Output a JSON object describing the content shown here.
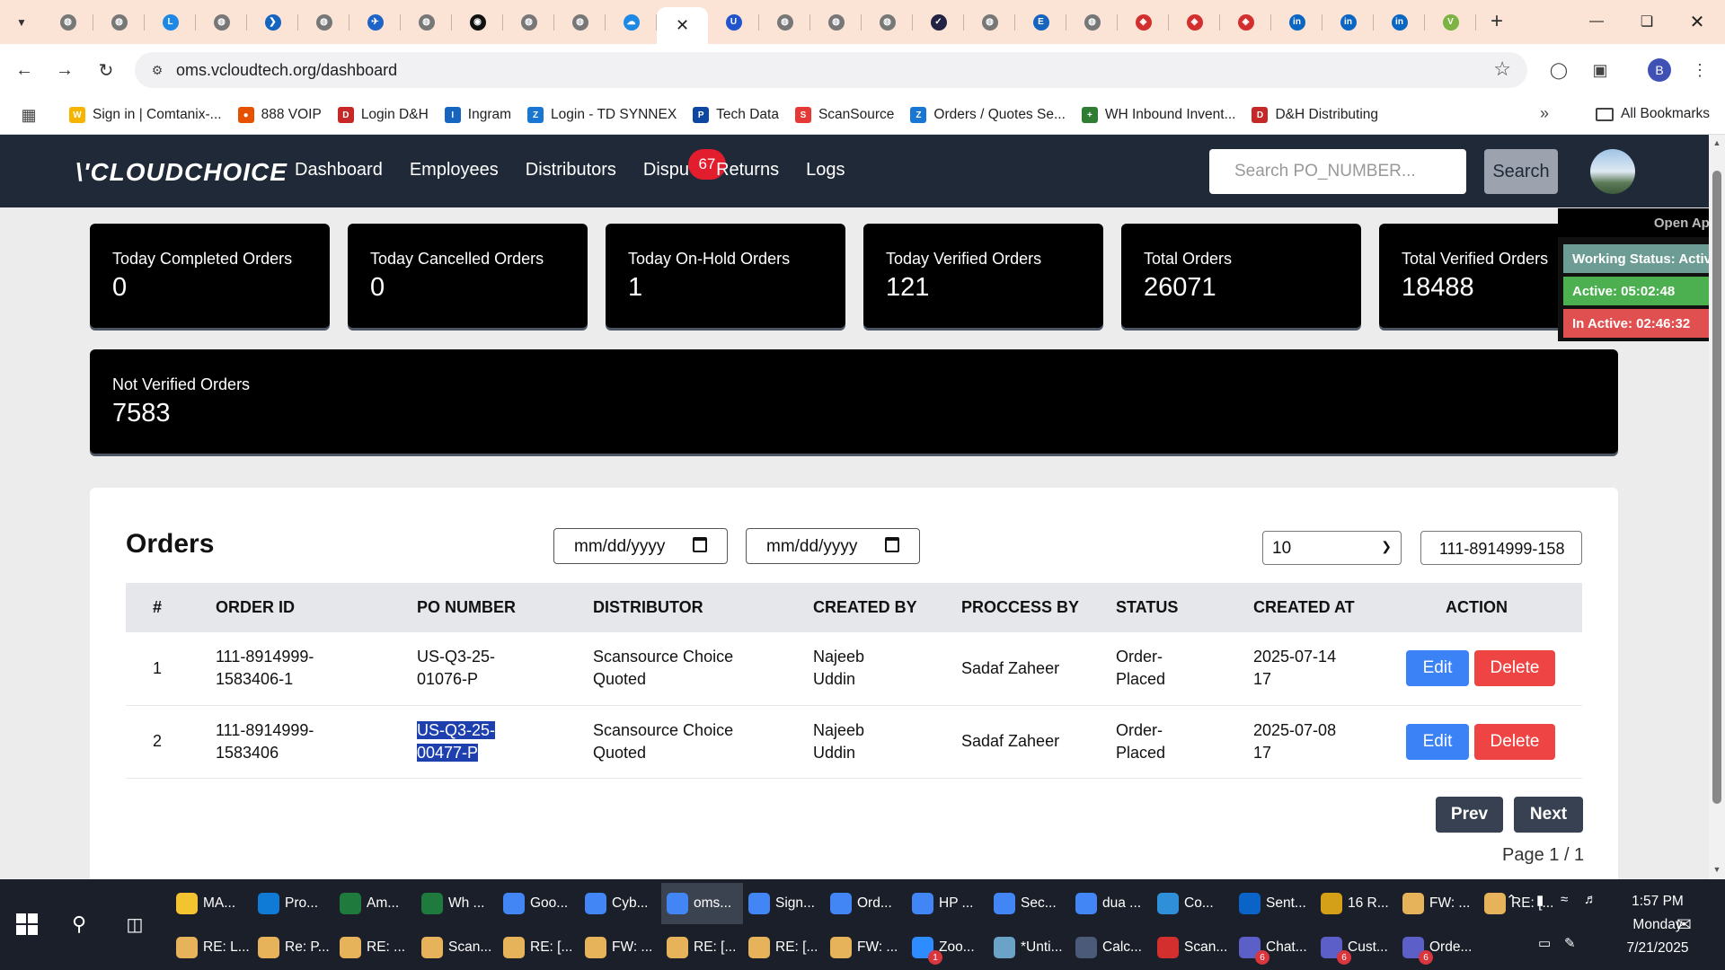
{
  "browser": {
    "tabs": [
      {
        "icon": "globe-icon",
        "color": "#777777",
        "glyph": "◍"
      },
      {
        "icon": "globe-icon",
        "color": "#777777",
        "glyph": "◍"
      },
      {
        "icon": "logi-icon",
        "color": "#1e88e5",
        "glyph": "L"
      },
      {
        "icon": "globe-icon",
        "color": "#777777",
        "glyph": "◍"
      },
      {
        "icon": "chevron-logo-icon",
        "color": "#1565c0",
        "glyph": "❯"
      },
      {
        "icon": "globe-icon",
        "color": "#777777",
        "glyph": "◍"
      },
      {
        "icon": "bird-logo-icon",
        "color": "#1e63c8",
        "glyph": "✈"
      },
      {
        "icon": "globe-icon",
        "color": "#777777",
        "glyph": "◍"
      },
      {
        "icon": "camera-lens-icon",
        "color": "#111111",
        "glyph": "◉"
      },
      {
        "icon": "globe-icon",
        "color": "#777777",
        "glyph": "◍"
      },
      {
        "icon": "globe-icon",
        "color": "#777777",
        "glyph": "◍"
      },
      {
        "icon": "cloud-logo-icon",
        "color": "#1e88e5",
        "glyph": "☁"
      },
      {
        "icon": "close-icon",
        "color": "#222222",
        "glyph": "✕",
        "active": true
      },
      {
        "icon": "u-logo-icon",
        "color": "#2155cd",
        "glyph": "U"
      },
      {
        "icon": "globe-icon",
        "color": "#777777",
        "glyph": "◍"
      },
      {
        "icon": "globe-icon",
        "color": "#777777",
        "glyph": "◍"
      },
      {
        "icon": "globe-icon",
        "color": "#777777",
        "glyph": "◍"
      },
      {
        "icon": "check-logo-icon",
        "color": "#222244",
        "glyph": "✓"
      },
      {
        "icon": "globe-icon",
        "color": "#777777",
        "glyph": "◍"
      },
      {
        "icon": "etn-logo-icon",
        "color": "#1565c0",
        "glyph": "E"
      },
      {
        "icon": "globe-icon",
        "color": "#777777",
        "glyph": "◍"
      },
      {
        "icon": "shield-red-icon",
        "color": "#d32f2f",
        "glyph": "◈"
      },
      {
        "icon": "shield-red-icon",
        "color": "#d32f2f",
        "glyph": "◈"
      },
      {
        "icon": "shield-red-icon",
        "color": "#d32f2f",
        "glyph": "◈"
      },
      {
        "icon": "linkedin-icon",
        "color": "#0a66c2",
        "glyph": "in"
      },
      {
        "icon": "linkedin-icon",
        "color": "#0a66c2",
        "glyph": "in"
      },
      {
        "icon": "linkedin-icon",
        "color": "#0a66c2",
        "glyph": "in"
      },
      {
        "icon": "v-logo-icon",
        "color": "#7cb342",
        "glyph": "V"
      }
    ],
    "url": "oms.vcloudtech.org/dashboard",
    "profile_letter": "B",
    "bookmarks": [
      {
        "label": "Sign in | Comtanix-...",
        "icon": "w-logo-icon",
        "color": "#f4b400",
        "glyph": "W"
      },
      {
        "label": "888 VOIP",
        "icon": "people-icon",
        "color": "#e65100",
        "glyph": "●"
      },
      {
        "label": "Login D&H",
        "icon": "dh-logo-icon",
        "color": "#c62828",
        "glyph": "D"
      },
      {
        "label": "Ingram",
        "icon": "ingram-logo-icon",
        "color": "#1565c0",
        "glyph": "I"
      },
      {
        "label": "Login - TD SYNNEX",
        "icon": "zc-logo-icon",
        "color": "#1976d2",
        "glyph": "Z"
      },
      {
        "label": "Tech Data",
        "icon": "p-logo-icon",
        "color": "#0d47a1",
        "glyph": "P"
      },
      {
        "label": "ScanSource",
        "icon": "scansource-logo-icon",
        "color": "#e53935",
        "glyph": "S"
      },
      {
        "label": "Orders / Quotes Se...",
        "icon": "zc-logo-icon",
        "color": "#1976d2",
        "glyph": "Z"
      },
      {
        "label": "WH Inbound Invent...",
        "icon": "plus-green-icon",
        "color": "#2e7d32",
        "glyph": "+"
      },
      {
        "label": "D&H Distributing",
        "icon": "dh-logo-icon",
        "color": "#c62828",
        "glyph": "D"
      }
    ],
    "all_bookmarks_label": "All Bookmarks"
  },
  "app": {
    "logo_text": "\\'CLOUDCHOICE",
    "nav": [
      {
        "label": "Dashboard"
      },
      {
        "label": "Employees"
      },
      {
        "label": "Distributors"
      },
      {
        "label": "Dispu",
        "badge": "67"
      },
      {
        "label": "Returns"
      },
      {
        "label": "Logs"
      }
    ],
    "search_placeholder": "Search PO_NUMBER...",
    "search_button": "Search",
    "stats": [
      {
        "label": "Today Completed Orders",
        "value": "0"
      },
      {
        "label": "Today Cancelled Orders",
        "value": "0"
      },
      {
        "label": "Today On-Hold Orders",
        "value": "1"
      },
      {
        "label": "Today Verified Orders",
        "value": "121"
      },
      {
        "label": "Total Orders",
        "value": "26071"
      },
      {
        "label": "Total Verified Orders",
        "value": "18488"
      }
    ],
    "not_verified": {
      "label": "Not Verified Orders",
      "value": "7583"
    },
    "widget": {
      "open_app": "Open App",
      "working_status": "Working Status: Active",
      "active": "Active: 05:02:48",
      "inactive": "In Active: 02:46:32",
      "colors": {
        "status": "#6c9c93",
        "active": "#4caf50",
        "inactive": "#e05050"
      }
    },
    "orders": {
      "title": "Orders",
      "date_from": "mm/dd/yyyy",
      "date_to": "mm/dd/yyyy",
      "page_size": "10",
      "filter_value": "111-8914999-158",
      "columns": [
        "#",
        "ORDER ID",
        "PO NUMBER",
        "DISTRIBUTOR",
        "CREATED BY",
        "PROCCESS BY",
        "STATUS",
        "CREATED AT",
        "ACTION"
      ],
      "rows": [
        {
          "num": "1",
          "order_id": [
            "111-8914999-",
            "1583406-1"
          ],
          "po": [
            "US-Q3-25-",
            "01076-P"
          ],
          "distributor": [
            "Scansource Choice",
            "Quoted"
          ],
          "created_by": [
            "Najeeb",
            "Uddin"
          ],
          "process_by": "Sadaf Zaheer",
          "status": [
            "Order-",
            "Placed"
          ],
          "created_at": [
            "2025-07-14",
            "17"
          ],
          "selected": false
        },
        {
          "num": "2",
          "order_id": [
            "111-8914999-",
            "1583406"
          ],
          "po": [
            "US-Q3-25-",
            "00477-P"
          ],
          "distributor": [
            "Scansource Choice",
            "Quoted"
          ],
          "created_by": [
            "Najeeb",
            "Uddin"
          ],
          "process_by": "Sadaf Zaheer",
          "status": [
            "Order-",
            "Placed"
          ],
          "created_at": [
            "2025-07-08",
            "17"
          ],
          "selected": true
        }
      ],
      "edit_label": "Edit",
      "delete_label": "Delete",
      "prev_label": "Prev",
      "next_label": "Next",
      "page_info": "Page 1 / 1"
    }
  },
  "taskbar": {
    "row1": [
      {
        "label": "MA...",
        "icon": "folder-note-icon",
        "color": "#f4c430"
      },
      {
        "label": "Pro...",
        "icon": "edge-icon",
        "color": "#0f7bd6"
      },
      {
        "label": "Am...",
        "icon": "excel-icon",
        "color": "#1f7a3e"
      },
      {
        "label": "Wh ...",
        "icon": "excel-icon",
        "color": "#1f7a3e"
      },
      {
        "label": "Goo...",
        "icon": "chrome-icon",
        "color": "#4285f4"
      },
      {
        "label": "Cyb...",
        "icon": "chrome-icon",
        "color": "#4285f4"
      },
      {
        "label": "oms...",
        "icon": "chrome-icon",
        "color": "#4285f4",
        "active": true
      },
      {
        "label": "Sign...",
        "icon": "chrome-icon",
        "color": "#4285f4"
      },
      {
        "label": "Ord...",
        "icon": "chrome-icon",
        "color": "#4285f4"
      },
      {
        "label": "HP ...",
        "icon": "chrome-icon",
        "color": "#4285f4"
      },
      {
        "label": "Sec...",
        "icon": "chrome-icon",
        "color": "#4285f4"
      },
      {
        "label": "dua ...",
        "icon": "chrome-icon",
        "color": "#4285f4"
      },
      {
        "label": "Co...",
        "icon": "diamond-app-icon",
        "color": "#2f8fd8"
      },
      {
        "label": "Sent...",
        "icon": "outlook-icon",
        "color": "#0a64c8"
      },
      {
        "label": "16 R...",
        "icon": "bell-icon",
        "color": "#d4a017"
      },
      {
        "label": "FW: ...",
        "icon": "mail-icon",
        "color": "#e6b35a"
      },
      {
        "label": "RE: [...",
        "icon": "mail-icon",
        "color": "#e6b35a"
      }
    ],
    "row2": [
      {
        "label": "RE: L...",
        "icon": "mail-icon",
        "color": "#e6b35a"
      },
      {
        "label": "Re: P...",
        "icon": "mail-icon",
        "color": "#e6b35a"
      },
      {
        "label": "RE: ...",
        "icon": "mail-icon",
        "color": "#e6b35a"
      },
      {
        "label": "Scan...",
        "icon": "mail-icon",
        "color": "#e6b35a"
      },
      {
        "label": "RE: [...",
        "icon": "mail-icon",
        "color": "#e6b35a"
      },
      {
        "label": "FW: ...",
        "icon": "mail-icon",
        "color": "#e6b35a"
      },
      {
        "label": "RE: [...",
        "icon": "mail-icon",
        "color": "#e6b35a"
      },
      {
        "label": "RE: [...",
        "icon": "mail-icon",
        "color": "#e6b35a"
      },
      {
        "label": "FW: ...",
        "icon": "mail-icon",
        "color": "#e6b35a"
      },
      {
        "label": "Zoo...",
        "icon": "zoom-icon",
        "color": "#2d8cff",
        "count": "1"
      },
      {
        "label": "*Unti...",
        "icon": "notepad-icon",
        "color": "#6ba3c8"
      },
      {
        "label": "Calc...",
        "icon": "calculator-icon",
        "color": "#4a5a78"
      },
      {
        "label": "Scan...",
        "icon": "pdf-icon",
        "color": "#d32f2f"
      },
      {
        "label": "Chat...",
        "icon": "teams-icon",
        "color": "#5b5fc7",
        "count": "6"
      },
      {
        "label": "Cust...",
        "icon": "teams-icon",
        "color": "#5b5fc7",
        "count": "6"
      },
      {
        "label": "Orde...",
        "icon": "teams-icon",
        "color": "#5b5fc7",
        "count": "6"
      }
    ],
    "time": "1:57 PM",
    "day": "Monday",
    "date": "7/21/2025"
  }
}
